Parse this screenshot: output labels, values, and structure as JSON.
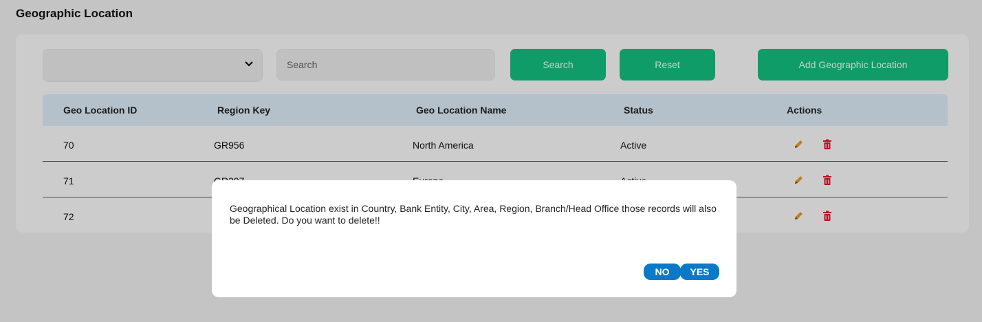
{
  "page": {
    "title": "Geographic Location"
  },
  "toolbar": {
    "select_value": "",
    "search_placeholder": "Search",
    "search_label": "Search",
    "reset_label": "Reset",
    "add_label": "Add Geographic Location"
  },
  "table": {
    "columns": [
      "Geo Location ID",
      "Region Key",
      "Geo Location Name",
      "Status",
      "Actions"
    ],
    "rows": [
      {
        "id": "70",
        "region_key": "GR956",
        "name": "North America",
        "status": "Active"
      },
      {
        "id": "71",
        "region_key": "GR397",
        "name": "Europe",
        "status": "Active"
      },
      {
        "id": "72",
        "region_key": "",
        "name": "",
        "status": ""
      }
    ]
  },
  "dialog": {
    "message": "Geographical Location exist in Country, Bank Entity, City, Area, Region, Branch/Head Office those records will also be Deleted. Do you want to delete!!",
    "no_label": "NO",
    "yes_label": "YES"
  },
  "icons": {
    "edit": "pencil-icon",
    "delete": "trash-icon",
    "dropdown": "chevron-down-icon"
  },
  "colors": {
    "primary_button": "#14c383",
    "dialog_button": "#0a7ac8",
    "delete_icon": "#e0192f",
    "edit_icon": "#f0a020",
    "table_header": "#e3f2fd"
  }
}
